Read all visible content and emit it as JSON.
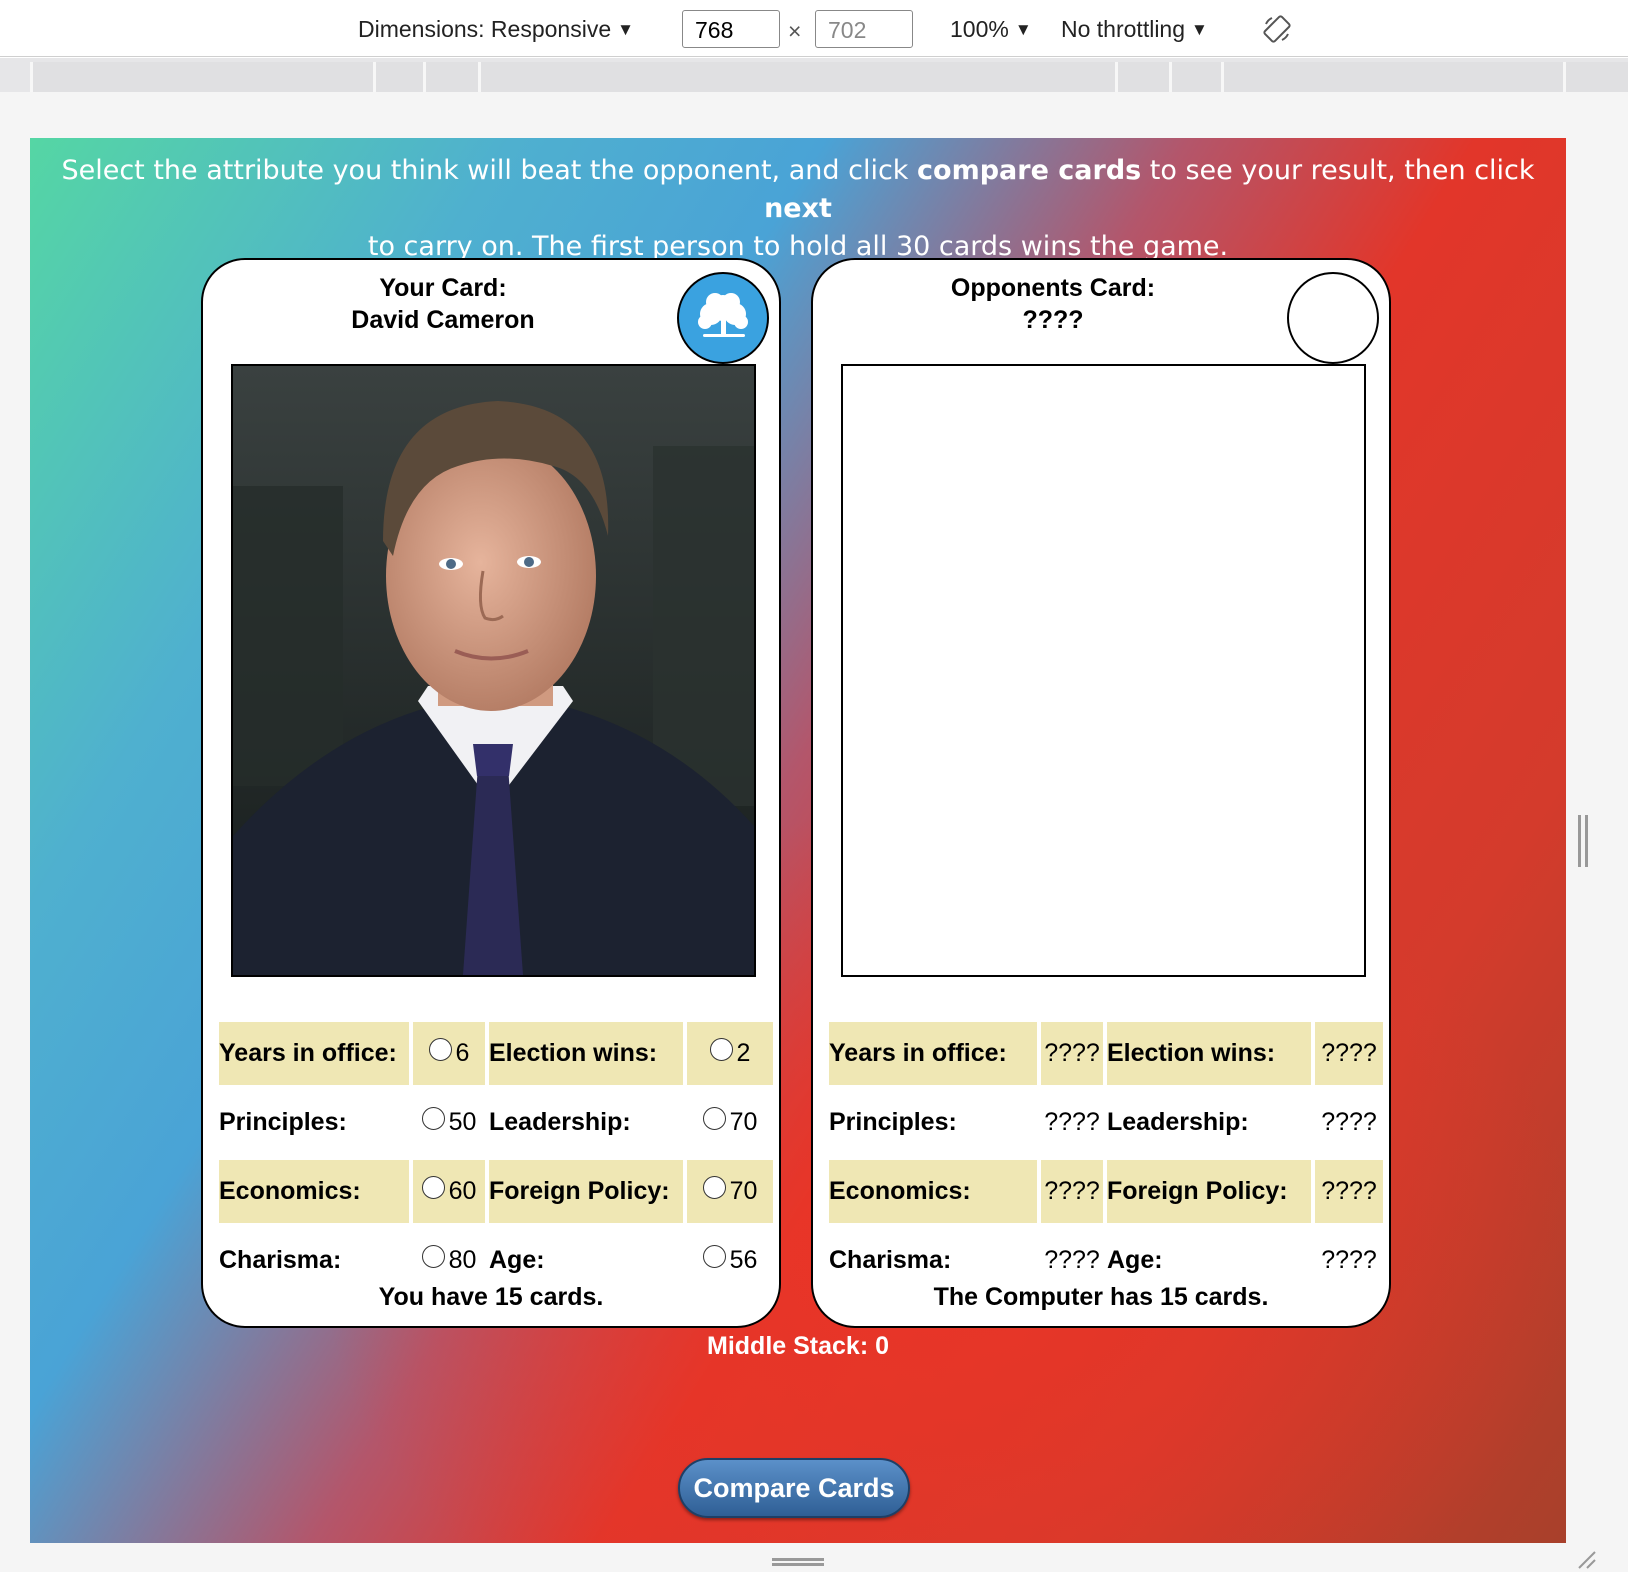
{
  "devtools": {
    "dimensions_label": "Dimensions: Responsive",
    "width_value": "768",
    "height_value": "702",
    "times": "×",
    "zoom": "100%",
    "throttling": "No throttling",
    "caret": "▼",
    "rotate_icon": "rotate-icon"
  },
  "game": {
    "instructions_part1": "Select the attribute you think will beat the opponent, and click ",
    "instructions_bold1": "compare cards",
    "instructions_part2": " to see your result, then click ",
    "instructions_bold2": "next",
    "instructions_part3": " to carry on. The first person to hold all 30 cards wins the game.",
    "player_card": {
      "heading_line1": "Your Card:",
      "heading_line2": "David Cameron",
      "party_badge_color": "#3aa2e0",
      "party_icon": "oak-tree-icon",
      "stats": [
        [
          {
            "label": "Years in office:",
            "value": "6"
          },
          {
            "label": "Election wins:",
            "value": "2"
          }
        ],
        [
          {
            "label": "Principles:",
            "value": "50"
          },
          {
            "label": "Leadership:",
            "value": "70"
          }
        ],
        [
          {
            "label": "Economics:",
            "value": "60"
          },
          {
            "label": "Foreign Policy:",
            "value": "70"
          }
        ],
        [
          {
            "label": "Charisma:",
            "value": "80"
          },
          {
            "label": "Age:",
            "value": "56"
          }
        ]
      ],
      "count_text": "You have 15 cards."
    },
    "opponent_card": {
      "heading_line1": "Opponents Card:",
      "heading_line2": "????",
      "stats": [
        [
          {
            "label": "Years in office:",
            "value": "????"
          },
          {
            "label": "Election wins:",
            "value": "????"
          }
        ],
        [
          {
            "label": "Principles:",
            "value": "????"
          },
          {
            "label": "Leadership:",
            "value": "????"
          }
        ],
        [
          {
            "label": "Economics:",
            "value": "????"
          },
          {
            "label": "Foreign Policy:",
            "value": "????"
          }
        ],
        [
          {
            "label": "Charisma:",
            "value": "????"
          },
          {
            "label": "Age:",
            "value": "????"
          }
        ]
      ],
      "count_text": "The Computer has 15 cards."
    },
    "middle_stack": "Middle Stack: 0",
    "compare_button": "Compare Cards",
    "highlight_color": "#efe7b4"
  }
}
